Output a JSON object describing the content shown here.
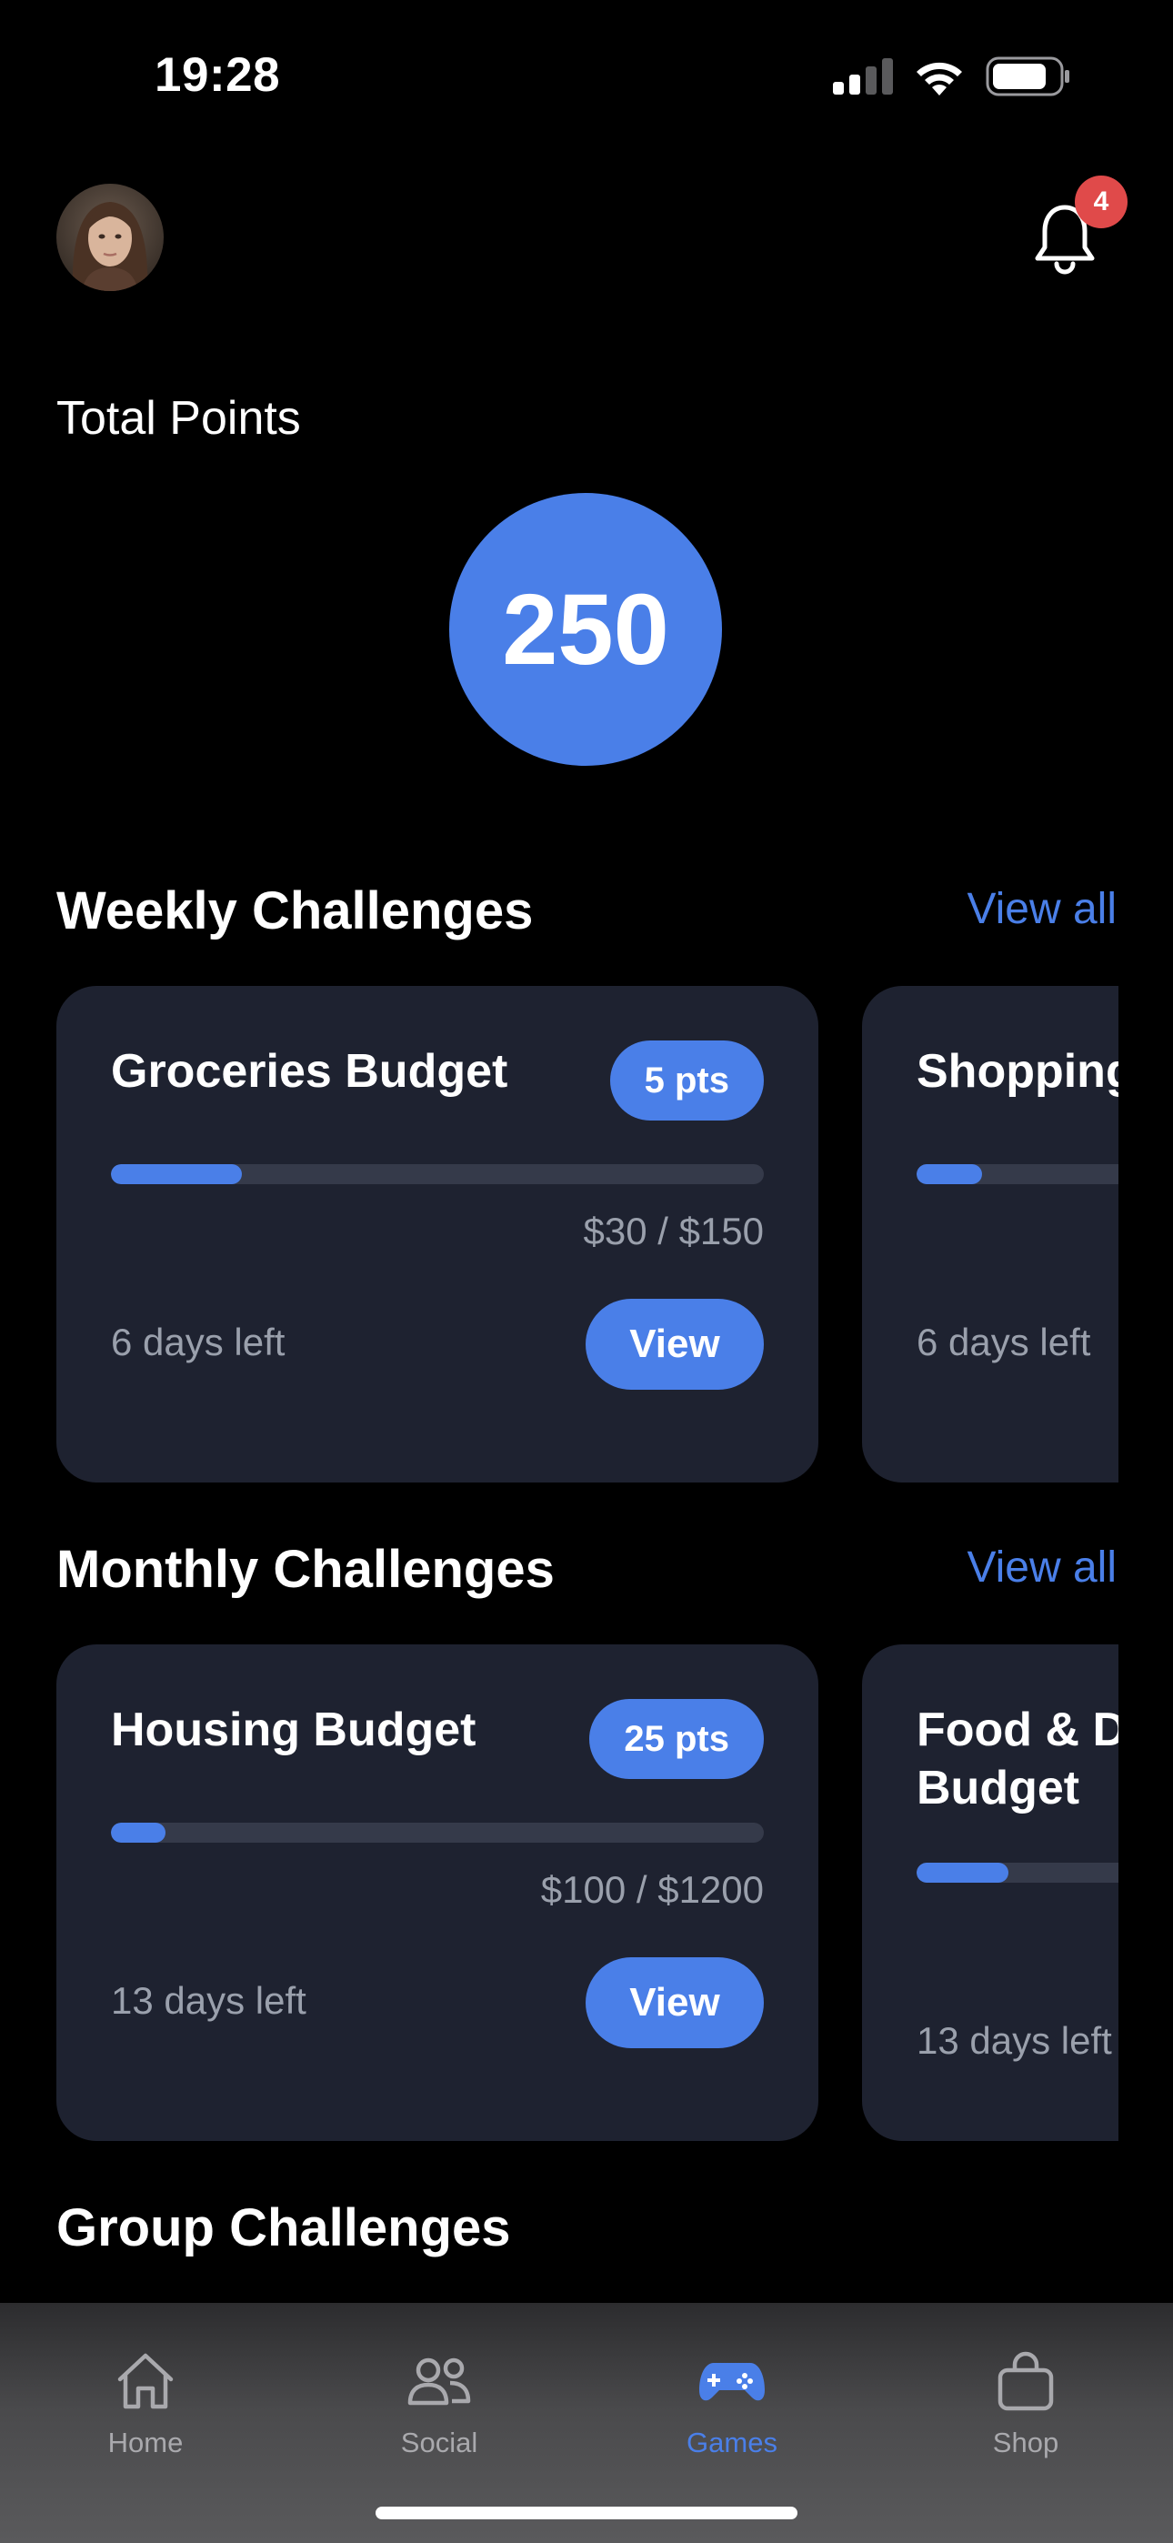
{
  "status": {
    "time": "19:28"
  },
  "header": {
    "notification_count": "4"
  },
  "points": {
    "label": "Total Points",
    "value": "250"
  },
  "weekly": {
    "title": "Weekly Challenges",
    "view_all": "View all",
    "cards": [
      {
        "title": "Groceries Budget",
        "points": "5 pts",
        "progress": 0.2,
        "amount": "$30 / $150",
        "days_left": "6 days left",
        "button": "View"
      },
      {
        "title": "Shopping",
        "progress": 0.1,
        "days_left": "6 days left"
      }
    ]
  },
  "monthly": {
    "title": "Monthly Challenges",
    "view_all": "View all",
    "cards": [
      {
        "title": "Housing Budget",
        "points": "25 pts",
        "progress": 0.083,
        "amount": "$100 / $1200",
        "days_left": "13 days left",
        "button": "View"
      },
      {
        "title_line1": "Food & D",
        "title_line2": "Budget",
        "progress": 0.14,
        "days_left": "13 days left"
      }
    ]
  },
  "group": {
    "title": "Group Challenges"
  },
  "tabs": [
    {
      "label": "Home",
      "icon": "home-icon"
    },
    {
      "label": "Social",
      "icon": "people-icon"
    },
    {
      "label": "Games",
      "icon": "gamepad-icon",
      "active": true
    },
    {
      "label": "Shop",
      "icon": "bag-icon"
    }
  ],
  "colors": {
    "accent": "#4a7fe8",
    "card_bg": "#1e2230",
    "badge_red": "#e04a4a"
  }
}
